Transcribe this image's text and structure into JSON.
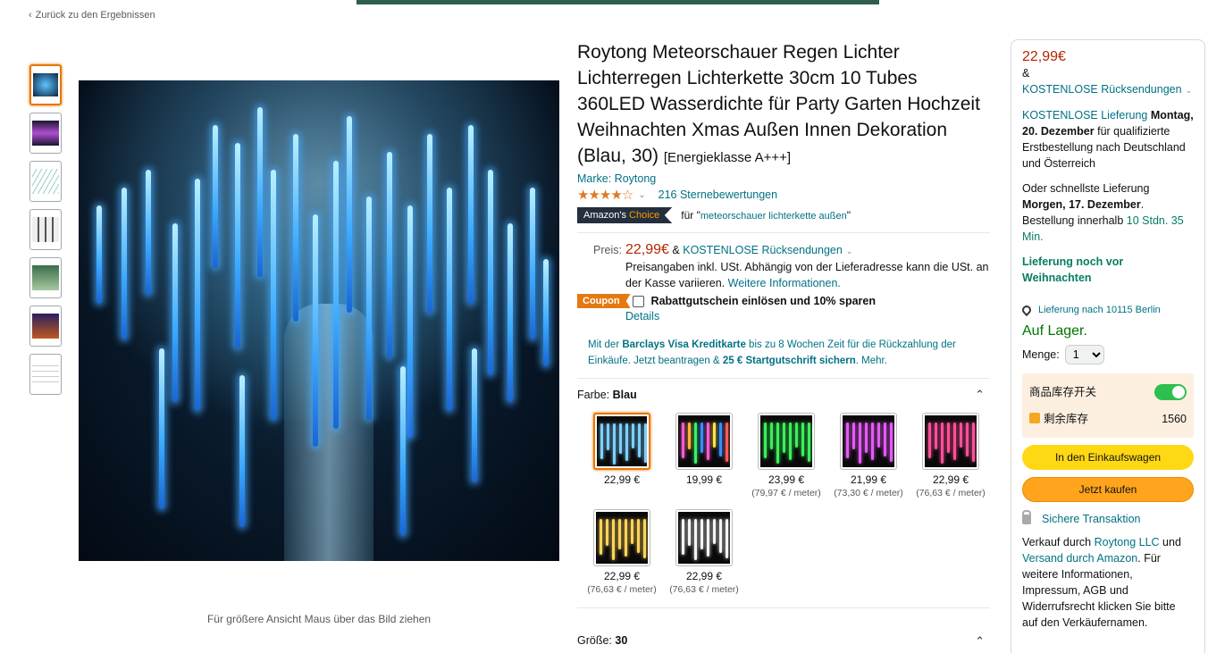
{
  "nav": {
    "back": "Zurück zu den Ergebnissen"
  },
  "gallery": {
    "zoom_hint": "Für größere Ansicht Maus über das Bild ziehen"
  },
  "product": {
    "title": "Roytong Meteorschauer Regen Lichter Lichterregen Lichterkette 30cm 10 Tubes 360LED Wasserdichte für Party Garten Hochzeit Weihnachten Xmas Außen Innen Dekoration (Blau, 30)",
    "energy": "[Energieklasse A+++]",
    "brand": "Marke: Roytong",
    "stars": "★★★★☆",
    "rating_count": "216 Sternebewertungen",
    "choice_prefix": "Amazon's",
    "choice_word": "Choice",
    "choice_for": "für \"",
    "choice_keyword": "meteorschauer lichterkette außen",
    "choice_close": "\""
  },
  "price": {
    "label": "Preis:",
    "value": "22,99€",
    "amp": "&",
    "returns": "KOSTENLOSE Rücksendungen",
    "tax_note": "Preisangaben inkl. USt. Abhängig von der Lieferadresse kann die USt. an der Kasse variieren.",
    "more_info": "Weitere Informationen."
  },
  "coupon": {
    "badge": "Coupon",
    "text": "Rabattgutschein einlösen und 10% sparen",
    "details": "Details"
  },
  "barclays": {
    "t1": "Mit der ",
    "card": "Barclays Visa Kreditkarte",
    "t2": " bis zu 8 Wochen Zeit für die Rückzahlung der Einkäufe. Jetzt beantragen & ",
    "credit": "25 € Startgutschrift sichern",
    "t3": ". Mehr."
  },
  "color": {
    "label": "Farbe:",
    "selected": "Blau",
    "options": [
      {
        "price": "22,99 €",
        "unit": ""
      },
      {
        "price": "19,99 €",
        "unit": ""
      },
      {
        "price": "23,99 €",
        "unit": "(79,97 € / meter)"
      },
      {
        "price": "21,99 €",
        "unit": "(73,30 € / meter)"
      },
      {
        "price": "22,99 €",
        "unit": "(76,63 € / meter)"
      },
      {
        "price": "22,99 €",
        "unit": "(76,63 € / meter)"
      },
      {
        "price": "22,99 €",
        "unit": "(76,63 € / meter)"
      }
    ]
  },
  "size": {
    "label": "Größe:",
    "selected": "30"
  },
  "buybox": {
    "price": "22,99€",
    "amp": "&",
    "returns": "KOSTENLOSE Rücksendungen",
    "delivery_link": "KOSTENLOSE Lieferung",
    "delivery_date": "Montag, 20. Dezember",
    "delivery_note": "für qualifizierte Erstbestellung nach Deutschland und Österreich",
    "fast_prefix": "Oder schnellste Lieferung",
    "fast_date": "Morgen, 17. Dezember",
    "order_within": "Bestellung innerhalb",
    "countdown": "10 Stdn. 35 Min.",
    "christmas": "Lieferung noch vor Weihnachten",
    "location": "Lieferung nach 10115 Berlin",
    "stock": "Auf Lager.",
    "qty_label": "Menge:",
    "qty_value": "1",
    "plugin_toggle_label": "商品库存开关",
    "plugin_stock_label": "剩余库存",
    "plugin_stock_value": "1560",
    "cart_button": "In den Einkaufswagen",
    "buy_button": "Jetzt kaufen",
    "secure": "Sichere Transaktion",
    "seller_t1": "Verkauf durch ",
    "seller": "Roytong LLC",
    "seller_t2": " und ",
    "ship": "Versand durch Amazon",
    "seller_t3": ". Für weitere Informationen, Impressum, AGB und Widerrufsrecht klicken Sie bitte auf den Verkäufernamen."
  },
  "colors": {
    "accent": "#e77600",
    "link": "#007185",
    "price": "#b12704",
    "cart": "#ffd814",
    "buy": "#ffa41c"
  }
}
